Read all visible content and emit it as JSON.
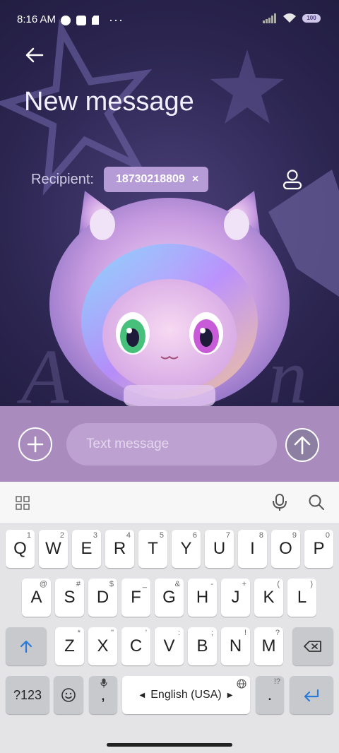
{
  "status_bar": {
    "time": "8:16 AM",
    "battery": "100"
  },
  "header": {
    "title": "New message"
  },
  "recipient": {
    "label": "Recipient:",
    "chip_number": "18730218809",
    "remove_symbol": "×"
  },
  "compose": {
    "placeholder": "Text message"
  },
  "keyboard": {
    "row1": [
      {
        "label": "Q",
        "hint": "1"
      },
      {
        "label": "W",
        "hint": "2"
      },
      {
        "label": "E",
        "hint": "3"
      },
      {
        "label": "R",
        "hint": "4"
      },
      {
        "label": "T",
        "hint": "5"
      },
      {
        "label": "Y",
        "hint": "6"
      },
      {
        "label": "U",
        "hint": "7"
      },
      {
        "label": "I",
        "hint": "8"
      },
      {
        "label": "O",
        "hint": "9"
      },
      {
        "label": "P",
        "hint": "0"
      }
    ],
    "row2": [
      {
        "label": "A",
        "hint": "@"
      },
      {
        "label": "S",
        "hint": "#"
      },
      {
        "label": "D",
        "hint": "$"
      },
      {
        "label": "F",
        "hint": "_"
      },
      {
        "label": "G",
        "hint": "&"
      },
      {
        "label": "H",
        "hint": "-"
      },
      {
        "label": "J",
        "hint": "+"
      },
      {
        "label": "K",
        "hint": "("
      },
      {
        "label": "L",
        "hint": ")"
      }
    ],
    "row3": [
      {
        "label": "Z",
        "hint": "*"
      },
      {
        "label": "X",
        "hint": "\""
      },
      {
        "label": "C",
        "hint": "'"
      },
      {
        "label": "V",
        "hint": ":"
      },
      {
        "label": "B",
        "hint": ";"
      },
      {
        "label": "N",
        "hint": "!"
      },
      {
        "label": "M",
        "hint": "?"
      }
    ],
    "symbols_key": "?123",
    "comma_key": ",",
    "space_label": "English (USA)",
    "period_key": ".",
    "period_hint": "!?"
  }
}
